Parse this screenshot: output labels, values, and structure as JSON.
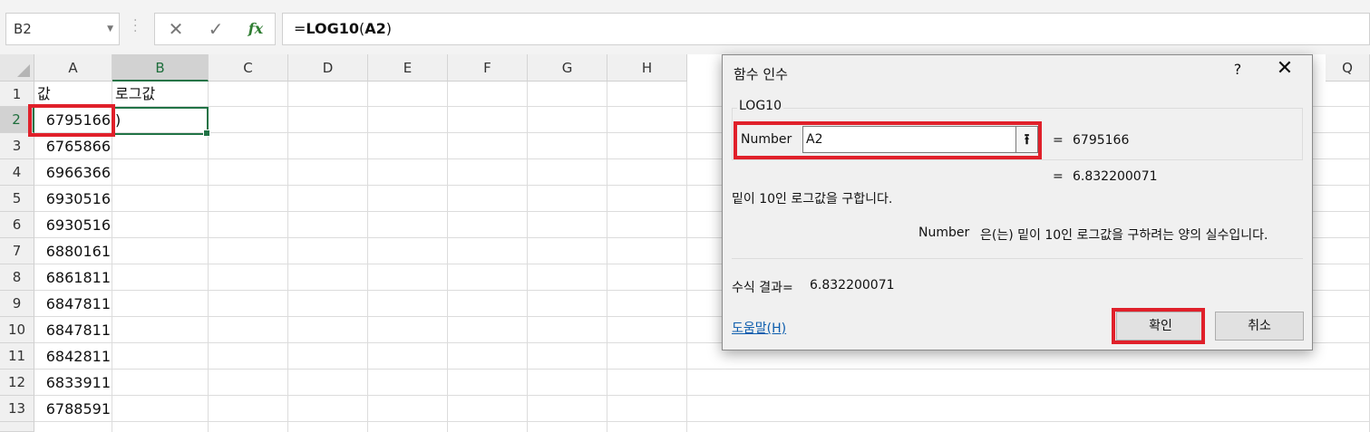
{
  "formula_bar": {
    "name_box": "B2",
    "cancel_glyph": "✕",
    "enter_glyph": "✓",
    "fx_label": "fx",
    "formula_prefix": "=",
    "formula_fn": "LOG10",
    "formula_open": "(",
    "formula_arg": "A2",
    "formula_close": ")"
  },
  "grid": {
    "columns": [
      "A",
      "B",
      "C",
      "D",
      "E",
      "F",
      "G",
      "H",
      "Q"
    ],
    "rows": [
      "1",
      "2",
      "3",
      "4",
      "5",
      "6",
      "7",
      "8",
      "9",
      "10",
      "11",
      "12",
      "13"
    ],
    "selected_column": "B",
    "selected_row": "2",
    "headers": {
      "a1": "값",
      "b1": "로그값"
    },
    "column_a_values": [
      "6795166",
      "6765866",
      "6966366",
      "6930516",
      "6930516",
      "6880161",
      "6861811",
      "6847811",
      "6847811",
      "6842811",
      "6833911",
      "6788591"
    ],
    "b2_value": ")"
  },
  "dialog": {
    "title": "함수 인수",
    "help_glyph": "?",
    "close_glyph": "✕",
    "function_name": "LOG10",
    "arg_label": "Number",
    "arg_value": "A2",
    "collapse_glyph": "⭱",
    "eq_sign": "=",
    "arg_result": "6795166",
    "func_result": "6.832200071",
    "description": "밑이 10인 로그값을 구합니다.",
    "arg_desc_name": "Number",
    "arg_desc_text": "은(는) 밑이 10인 로그값을 구하려는 양의 실수입니다.",
    "formula_result_label": "수식 결과=",
    "formula_result_value": "6.832200071",
    "help_link": "도움말(H)",
    "ok_label": "확인",
    "cancel_label": "취소"
  },
  "colors": {
    "accent": "#217346",
    "highlight": "#e0202a",
    "link": "#0b5cad"
  }
}
